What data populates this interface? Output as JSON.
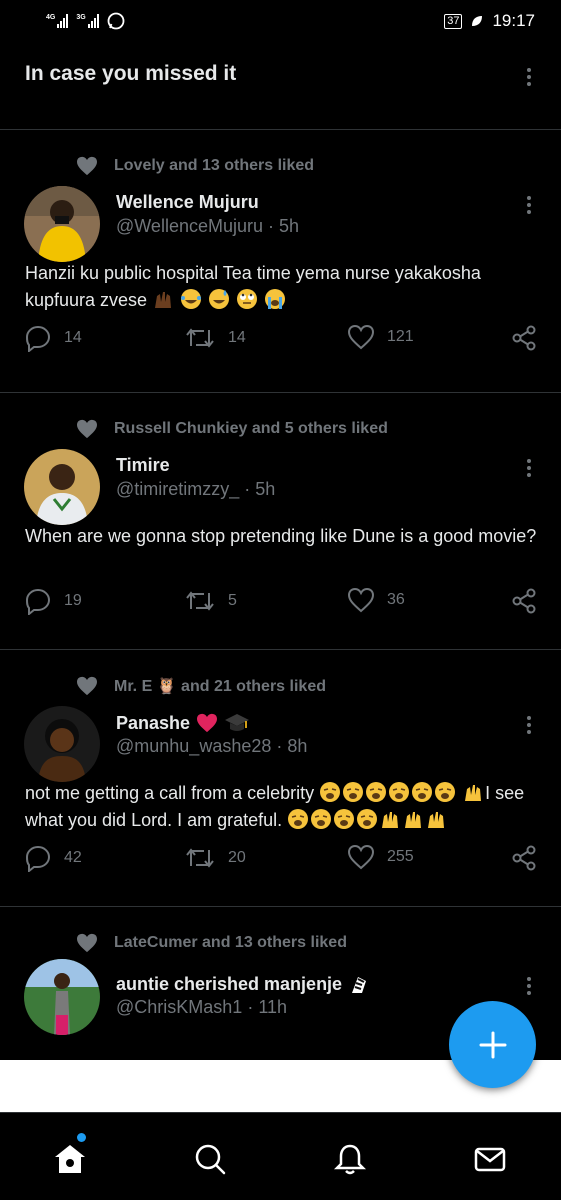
{
  "status_bar": {
    "network1": "4G",
    "network2": "3G",
    "battery": "37",
    "time": "19:17"
  },
  "header": {
    "title": "In case you missed it"
  },
  "tweets": [
    {
      "liked_by": "Lovely and 13 others liked",
      "name": "Wellence Mujuru",
      "name_suffix": "",
      "handle": "@WellenceMujuru",
      "time": "· 5h",
      "text": "Hanzii ku public hospital Tea time yema nurse yakakosha kupfuura zvese",
      "replies": "14",
      "retweets": "14",
      "likes": "121"
    },
    {
      "liked_by": "Russell Chunkiey and 5 others liked",
      "name": "Timire",
      "name_suffix": "",
      "handle": "@timiretimzzy_",
      "time": "· 5h",
      "text": "When are we gonna stop pretending like Dune is a good movie?",
      "replies": "19",
      "retweets": "5",
      "likes": "36"
    },
    {
      "liked_by": "Mr. E 🦉 and 21 others liked",
      "name": "Panashe",
      "name_suffix": "",
      "handle": "@munhu_washe28",
      "time": "· 8h",
      "text_part1": "not me getting a call from a celebrity",
      "text_part2": "I see what you did Lord. I am grateful.",
      "replies": "42",
      "retweets": "20",
      "likes": "255"
    },
    {
      "liked_by": "LateCumer and 13 others liked",
      "name": "auntie cherished manjenje",
      "handle": "@ChrisKMash1",
      "time": "· 11h"
    }
  ],
  "icons": {
    "reply": "reply-icon",
    "retweet": "retweet-icon",
    "like": "heart-icon",
    "share": "share-icon",
    "home": "home-icon",
    "search": "search-icon",
    "notifications": "bell-icon",
    "messages": "mail-icon",
    "compose": "plus-icon"
  },
  "colors": {
    "accent": "#1d9bf0",
    "muted": "#71767b",
    "background": "#000000",
    "text": "#e7e9ea"
  }
}
